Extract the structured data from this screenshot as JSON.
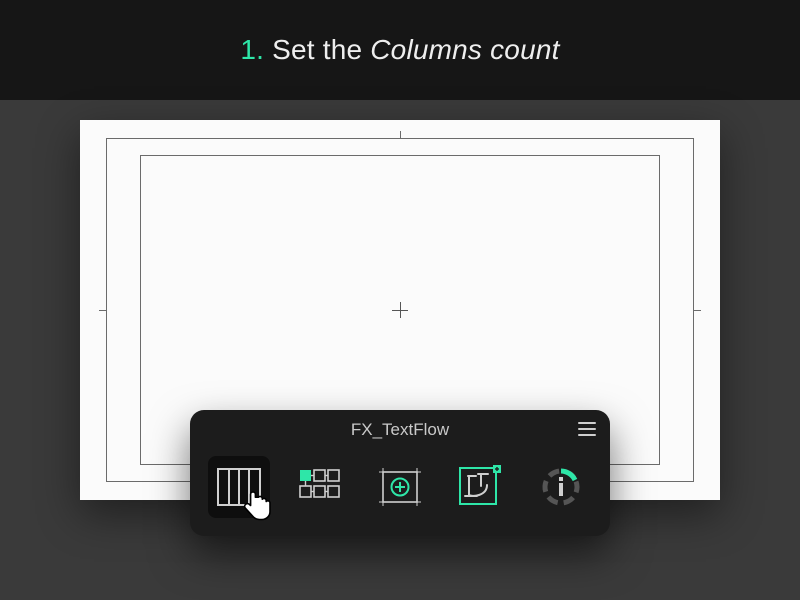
{
  "banner": {
    "number": "1.",
    "prefix": "Set the ",
    "emphasis": "Columns count"
  },
  "panel": {
    "title": "FX_TextFlow",
    "tools": [
      {
        "id": "columns",
        "name": "columns-tool",
        "active": true
      },
      {
        "id": "grid",
        "name": "grid-layout-tool",
        "active": false
      },
      {
        "id": "addframe",
        "name": "add-text-frame-tool",
        "active": false
      },
      {
        "id": "glyph",
        "name": "glyph-style-tool",
        "active": false
      },
      {
        "id": "info",
        "name": "info-settings-tool",
        "active": false
      }
    ]
  },
  "colors": {
    "accent": "#2ee6a8"
  }
}
